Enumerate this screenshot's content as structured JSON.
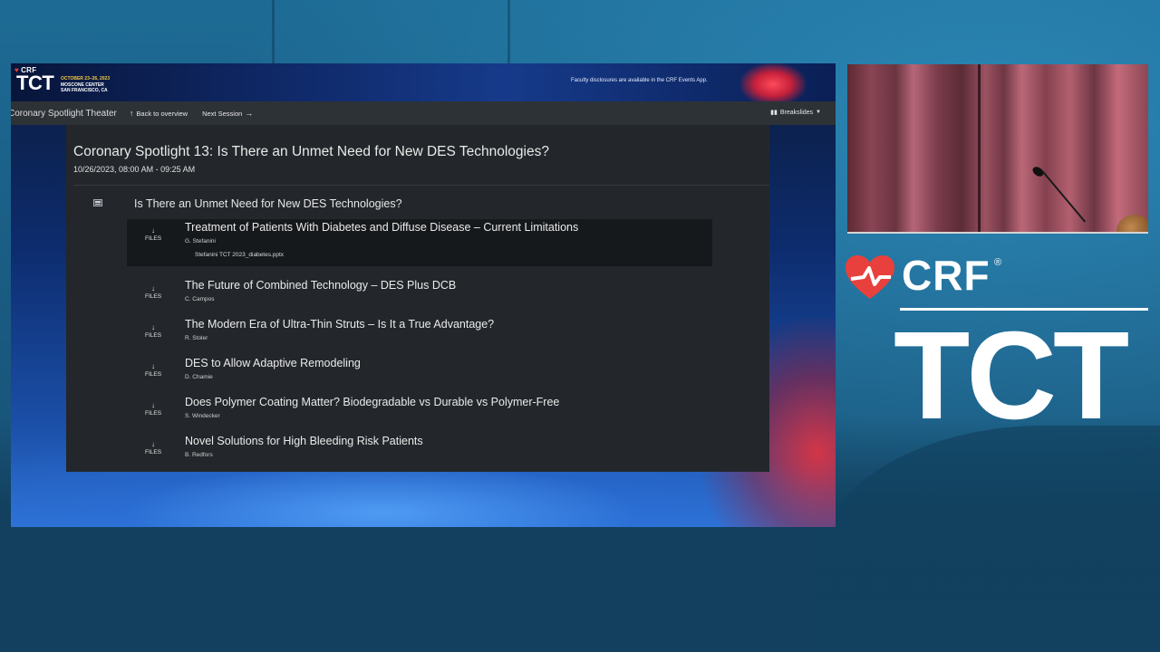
{
  "banner": {
    "crf_logo": "CRF",
    "tct_logo": "TCT",
    "event_date": "OCTOBER 23–26, 2023",
    "event_venue": "MOSCONE CENTER",
    "event_city": "SAN FRANCISCO, CA",
    "disclosure": "Faculty disclosures are available in the CRF Events App."
  },
  "nav": {
    "theater": "Coronary Spotlight Theater",
    "back_label": "Back to overview",
    "next_label": "Next Session",
    "breakslides_label": "Breakslides"
  },
  "session": {
    "title": "Coronary Spotlight 13: Is There an Unmet Need for New DES Technologies?",
    "datetime": "10/26/2023, 08:00 AM - 09:25 AM",
    "header_title": "Is There an Unmet Need for New DES Technologies?"
  },
  "talks": [
    {
      "files_label": "FILES",
      "title": "Treatment of Patients With Diabetes and Diffuse Disease – Current Limitations",
      "speaker": "G. Stefanini",
      "file": "Stefanini TCT 2023_diabetes.pptx"
    },
    {
      "files_label": "FILES",
      "title": "The Future of Combined Technology – DES Plus DCB",
      "speaker": "C. Campos"
    },
    {
      "files_label": "FILES",
      "title": "The Modern Era of Ultra-Thin Struts – Is It a True Advantage?",
      "speaker": "R. Stoler"
    },
    {
      "files_label": "FILES",
      "title": "DES to Allow Adaptive Remodeling",
      "speaker": "D. Chamie"
    },
    {
      "files_label": "FILES",
      "title": "Does Polymer Coating Matter? Biodegradable vs Durable vs Polymer-Free",
      "speaker": "S. Windecker"
    },
    {
      "files_label": "FILES",
      "title": "Novel Solutions for High Bleeding Risk Patients",
      "speaker": "B. Redfors"
    }
  ],
  "brand": {
    "crf": "CRF",
    "reg": "®",
    "tct": "TCT"
  },
  "colors": {
    "background": "#1e5f86",
    "panel": "#23272b",
    "nav": "#2d3237",
    "active_row": "#16191c",
    "crf_heart": "#e8403c"
  }
}
